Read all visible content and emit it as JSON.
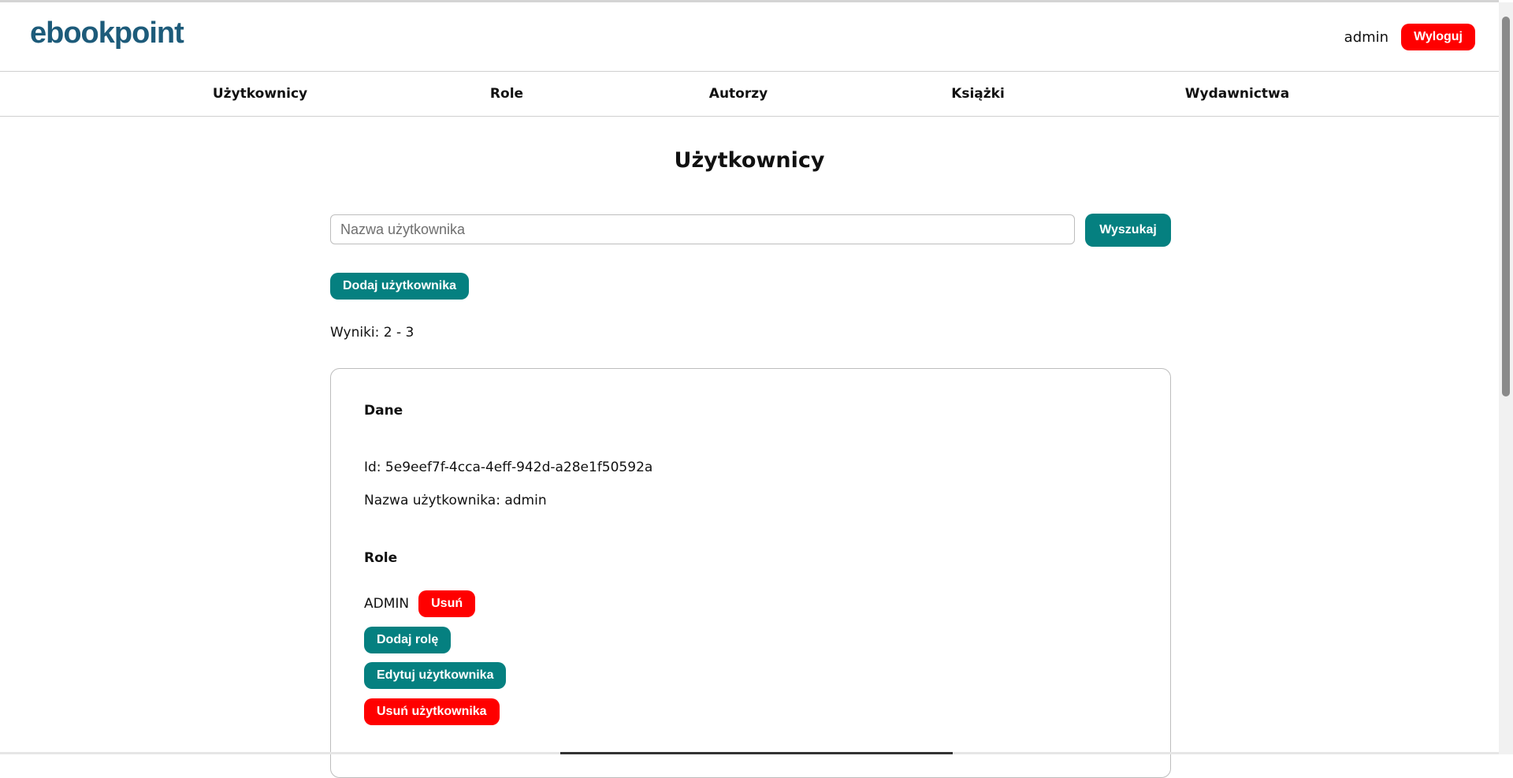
{
  "header": {
    "logo_text": "ebookpoint",
    "username": "admin",
    "logout_label": "Wyloguj",
    "colors": {
      "logo": "#1d5b7a",
      "danger": "#ff0000",
      "primary": "#058080"
    }
  },
  "nav": {
    "items": [
      {
        "label": "Użytkownicy"
      },
      {
        "label": "Role"
      },
      {
        "label": "Autorzy"
      },
      {
        "label": "Książki"
      },
      {
        "label": "Wydawnictwa"
      }
    ]
  },
  "main": {
    "title": "Użytkownicy",
    "search": {
      "placeholder": "Nazwa użytkownika",
      "value": "",
      "button_label": "Wyszukaj"
    },
    "add_user_label": "Dodaj użytkownika",
    "results_text": "Wyniki: 2 - 3"
  },
  "user_card": {
    "data_heading": "Dane",
    "id_text": "Id: 5e9eef7f-4cca-4eff-942d-a28e1f50592a",
    "username_text": "Nazwa użytkownika: admin",
    "roles_heading": "Role",
    "roles": [
      {
        "name": "ADMIN",
        "remove_label": "Usuń"
      }
    ],
    "add_role_label": "Dodaj rolę",
    "edit_user_label": "Edytuj użytkownika",
    "delete_user_label": "Usuń użytkownika"
  }
}
